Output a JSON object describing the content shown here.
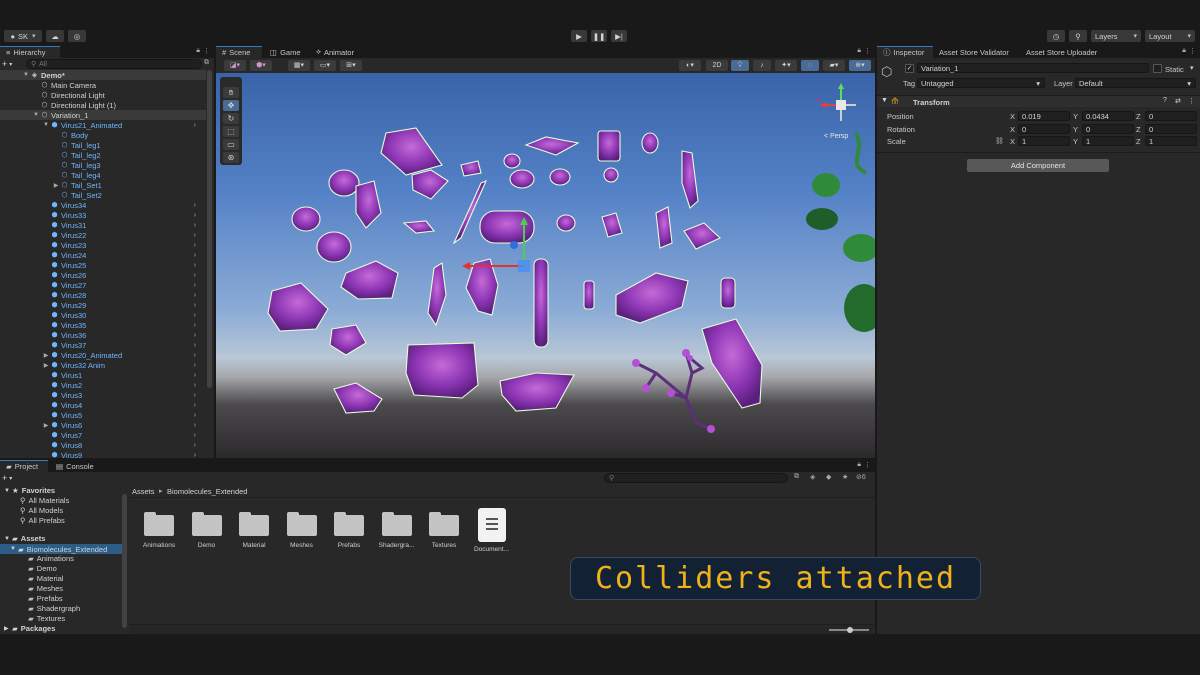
{
  "toolbar": {
    "account": "SK",
    "layers": "Layers",
    "layout": "Layout"
  },
  "hierarchy": {
    "tab": "Hierarchy",
    "search_placeholder": "All",
    "rows": [
      {
        "label": "Demo*",
        "indent": 0,
        "fold": "▼",
        "icon": "unity-scene-icon",
        "glyph": "◈",
        "color": "white",
        "chev": false
      },
      {
        "label": "Main Camera",
        "indent": 1,
        "fold": "",
        "icon": "gameobject-icon",
        "glyph": "⬡",
        "color": "white",
        "chev": false
      },
      {
        "label": "Directional Light",
        "indent": 1,
        "fold": "",
        "icon": "gameobject-icon",
        "glyph": "⬡",
        "color": "white",
        "chev": false
      },
      {
        "label": "Directional Light (1)",
        "indent": 1,
        "fold": "",
        "icon": "gameobject-icon",
        "glyph": "⬡",
        "color": "white",
        "chev": false
      },
      {
        "label": "Variation_1",
        "indent": 1,
        "fold": "▼",
        "icon": "gameobject-icon",
        "glyph": "⬡",
        "color": "white",
        "chev": false,
        "selected": true
      },
      {
        "label": "Virus21_Animated",
        "indent": 2,
        "fold": "▼",
        "icon": "prefab-icon",
        "glyph": "⬢",
        "color": "blue",
        "chev": true
      },
      {
        "label": "Body",
        "indent": 3,
        "fold": "",
        "icon": "prefab-icon",
        "glyph": "⬡",
        "color": "blue",
        "chev": false
      },
      {
        "label": "Tail_leg1",
        "indent": 3,
        "fold": "",
        "icon": "prefab-icon",
        "glyph": "⬡",
        "color": "blue",
        "chev": false
      },
      {
        "label": "Tail_leg2",
        "indent": 3,
        "fold": "",
        "icon": "prefab-icon",
        "glyph": "⬡",
        "color": "blue",
        "chev": false
      },
      {
        "label": "Tail_leg3",
        "indent": 3,
        "fold": "",
        "icon": "prefab-icon",
        "glyph": "⬡",
        "color": "blue",
        "chev": false
      },
      {
        "label": "Tail_leg4",
        "indent": 3,
        "fold": "",
        "icon": "prefab-icon",
        "glyph": "⬡",
        "color": "blue",
        "chev": false
      },
      {
        "label": "Tail_Set1",
        "indent": 3,
        "fold": "▶",
        "icon": "prefab-icon",
        "glyph": "⬡",
        "color": "blue",
        "chev": false
      },
      {
        "label": "Tail_Set2",
        "indent": 3,
        "fold": "",
        "icon": "prefab-icon",
        "glyph": "⬡",
        "color": "blue",
        "chev": false
      },
      {
        "label": "Virus34",
        "indent": 2,
        "fold": "",
        "icon": "prefab-icon",
        "glyph": "⬢",
        "color": "blue",
        "chev": true
      },
      {
        "label": "Virus33",
        "indent": 2,
        "fold": "",
        "icon": "prefab-icon",
        "glyph": "⬢",
        "color": "blue",
        "chev": true
      },
      {
        "label": "Virus31",
        "indent": 2,
        "fold": "",
        "icon": "prefab-icon",
        "glyph": "⬢",
        "color": "blue",
        "chev": true
      },
      {
        "label": "Virus22",
        "indent": 2,
        "fold": "",
        "icon": "prefab-icon",
        "glyph": "⬢",
        "color": "blue",
        "chev": true
      },
      {
        "label": "Virus23",
        "indent": 2,
        "fold": "",
        "icon": "prefab-icon",
        "glyph": "⬢",
        "color": "blue",
        "chev": true
      },
      {
        "label": "Virus24",
        "indent": 2,
        "fold": "",
        "icon": "prefab-icon",
        "glyph": "⬢",
        "color": "blue",
        "chev": true
      },
      {
        "label": "Virus25",
        "indent": 2,
        "fold": "",
        "icon": "prefab-icon",
        "glyph": "⬢",
        "color": "blue",
        "chev": true
      },
      {
        "label": "Virus26",
        "indent": 2,
        "fold": "",
        "icon": "prefab-icon",
        "glyph": "⬢",
        "color": "blue",
        "chev": true
      },
      {
        "label": "Virus27",
        "indent": 2,
        "fold": "",
        "icon": "prefab-icon",
        "glyph": "⬢",
        "color": "blue",
        "chev": true
      },
      {
        "label": "Virus28",
        "indent": 2,
        "fold": "",
        "icon": "prefab-icon",
        "glyph": "⬢",
        "color": "blue",
        "chev": true
      },
      {
        "label": "Virus29",
        "indent": 2,
        "fold": "",
        "icon": "prefab-icon",
        "glyph": "⬢",
        "color": "blue",
        "chev": true
      },
      {
        "label": "Virus30",
        "indent": 2,
        "fold": "",
        "icon": "prefab-icon",
        "glyph": "⬢",
        "color": "blue",
        "chev": true
      },
      {
        "label": "Virus35",
        "indent": 2,
        "fold": "",
        "icon": "prefab-icon",
        "glyph": "⬢",
        "color": "blue",
        "chev": true
      },
      {
        "label": "Virus36",
        "indent": 2,
        "fold": "",
        "icon": "prefab-icon",
        "glyph": "⬢",
        "color": "blue",
        "chev": true
      },
      {
        "label": "Virus37",
        "indent": 2,
        "fold": "",
        "icon": "prefab-icon",
        "glyph": "⬢",
        "color": "blue",
        "chev": true
      },
      {
        "label": "Virus20_Animated",
        "indent": 2,
        "fold": "▶",
        "icon": "prefab-icon",
        "glyph": "⬢",
        "color": "blue",
        "chev": true
      },
      {
        "label": "Virus32 Anim",
        "indent": 2,
        "fold": "▶",
        "icon": "prefab-icon",
        "glyph": "⬢",
        "color": "blue",
        "chev": true
      },
      {
        "label": "Virus1",
        "indent": 2,
        "fold": "",
        "icon": "prefab-icon",
        "glyph": "⬢",
        "color": "blue",
        "chev": true
      },
      {
        "label": "Virus2",
        "indent": 2,
        "fold": "",
        "icon": "prefab-icon",
        "glyph": "⬢",
        "color": "blue",
        "chev": true
      },
      {
        "label": "Virus3",
        "indent": 2,
        "fold": "",
        "icon": "prefab-icon",
        "glyph": "⬢",
        "color": "blue",
        "chev": true
      },
      {
        "label": "Virus4",
        "indent": 2,
        "fold": "",
        "icon": "prefab-icon",
        "glyph": "⬢",
        "color": "blue",
        "chev": true
      },
      {
        "label": "Virus5",
        "indent": 2,
        "fold": "",
        "icon": "prefab-icon",
        "glyph": "⬢",
        "color": "blue",
        "chev": true
      },
      {
        "label": "Virus6",
        "indent": 2,
        "fold": "▶",
        "icon": "prefab-icon",
        "glyph": "⬢",
        "color": "blue",
        "chev": true
      },
      {
        "label": "Virus7",
        "indent": 2,
        "fold": "",
        "icon": "prefab-icon",
        "glyph": "⬢",
        "color": "blue",
        "chev": true
      },
      {
        "label": "Virus8",
        "indent": 2,
        "fold": "",
        "icon": "prefab-icon",
        "glyph": "⬢",
        "color": "blue",
        "chev": true
      },
      {
        "label": "Virus9",
        "indent": 2,
        "fold": "",
        "icon": "prefab-icon",
        "glyph": "⬢",
        "color": "blue",
        "chev": true
      }
    ]
  },
  "scene": {
    "tabs": [
      "Scene",
      "Game",
      "Animator"
    ],
    "mode_2d": "2D",
    "persp": "< Persp",
    "axis_x": "x"
  },
  "inspector": {
    "tabs": [
      "Inspector",
      "Asset Store Validator",
      "Asset Store Uploader"
    ],
    "object_name": "Variation_1",
    "static": "Static",
    "tag_label": "Tag",
    "tag_value": "Untagged",
    "layer_label": "Layer",
    "layer_value": "Default",
    "component": "Transform",
    "position_label": "Position",
    "rotation_label": "Rotation",
    "scale_label": "Scale",
    "position": {
      "x": "0.019",
      "y": "0.0434",
      "z": "0"
    },
    "rotation": {
      "x": "0",
      "y": "0",
      "z": "0"
    },
    "scale": {
      "x": "1",
      "y": "1",
      "z": "1"
    },
    "axes": {
      "x": "X",
      "y": "Y",
      "z": "Z"
    },
    "add_component": "Add Component"
  },
  "project": {
    "tabs": [
      "Project",
      "Console"
    ],
    "badge": "6",
    "favorites_label": "Favorites",
    "favorites": [
      "All Materials",
      "All Models",
      "All Prefabs"
    ],
    "assets_label": "Assets",
    "tree_root": "Biomolecules_Extended",
    "tree_children": [
      "Animations",
      "Demo",
      "Material",
      "Meshes",
      "Prefabs",
      "Shadergraph",
      "Textures"
    ],
    "packages_label": "Packages",
    "breadcrumb_root": "Assets",
    "breadcrumb_sep": "▸",
    "breadcrumb_current": "Biomolecules_Extended",
    "grid_items": [
      {
        "label": "Animations",
        "kind": "folder"
      },
      {
        "label": "Demo",
        "kind": "folder"
      },
      {
        "label": "Material",
        "kind": "folder"
      },
      {
        "label": "Meshes",
        "kind": "folder"
      },
      {
        "label": "Prefabs",
        "kind": "folder"
      },
      {
        "label": "Shadergra...",
        "kind": "folder"
      },
      {
        "label": "Textures",
        "kind": "folder"
      },
      {
        "label": "Document...",
        "kind": "document"
      }
    ]
  },
  "caption": "Colliders attached",
  "colors": {
    "selection": "#2c5d87",
    "prefab_blue": "#6fb6ff",
    "virus_purple": "#9b3fc0",
    "collider_green": "#c8f5a0",
    "caption_text": "#f0b21a",
    "caption_bg": "#132134"
  }
}
